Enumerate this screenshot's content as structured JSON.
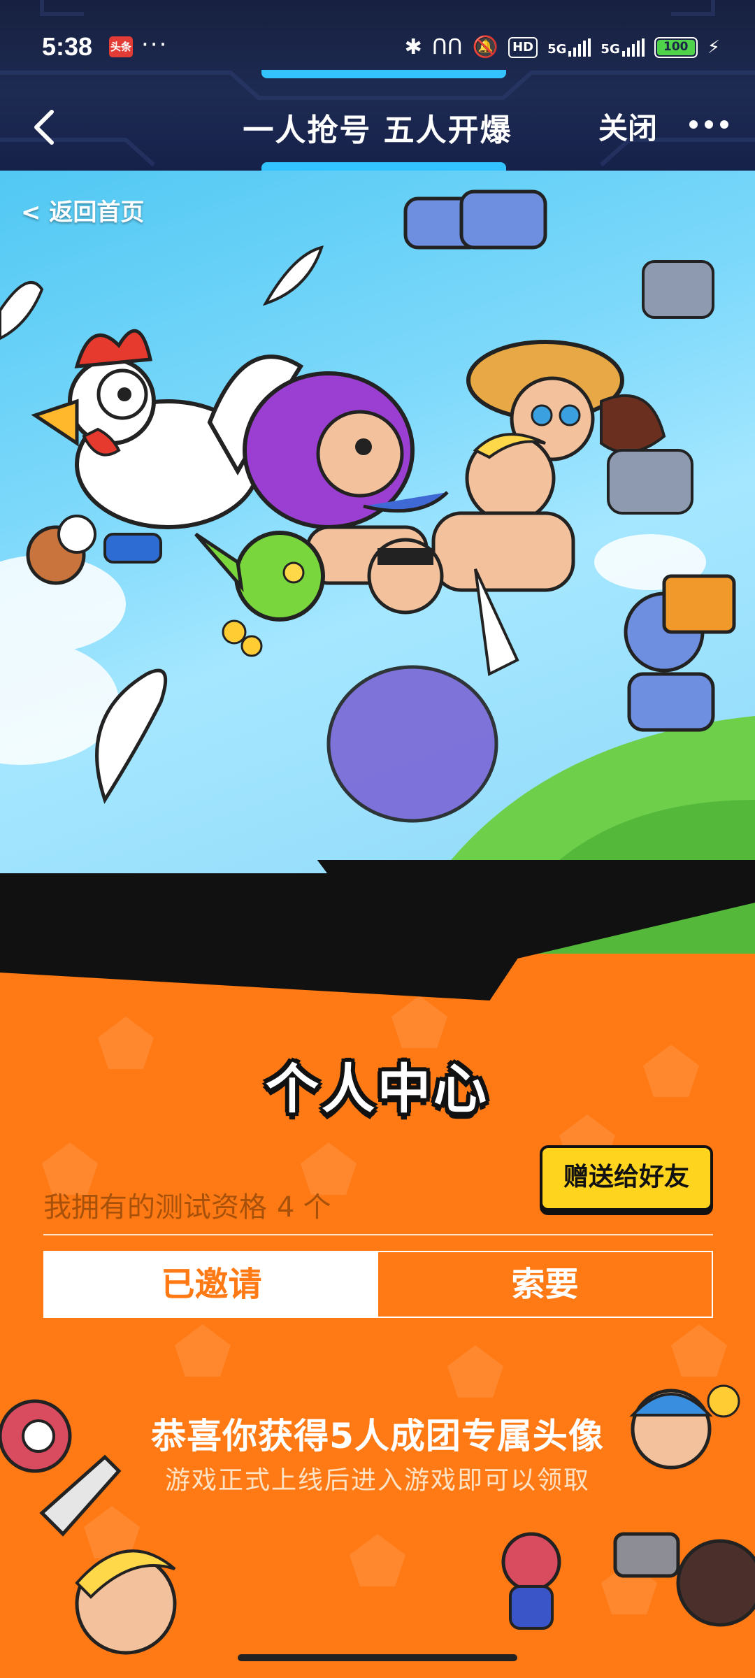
{
  "status_bar": {
    "time": "5:38",
    "app_badge": "头条",
    "more": "···",
    "hd_label": "HD",
    "signal1": "5G",
    "signal2": "5G",
    "battery": "100"
  },
  "nav": {
    "title": "一人抢号 五人开爆",
    "close_label": "关闭"
  },
  "hero": {
    "back_home_label": "< 返回首页"
  },
  "personal": {
    "title": "个人中心",
    "gift_button": "赠送给好友",
    "quota_label": "我拥有的测试资格",
    "quota_count": "4",
    "quota_unit": "个",
    "tabs": [
      {
        "label": "已邀请",
        "active": true
      },
      {
        "label": "索要",
        "active": false
      }
    ],
    "congrats_title": "恭喜你获得5人成团专属头像",
    "congrats_sub": "游戏正式上线后进入游戏即可以领取"
  },
  "colors": {
    "orange": "#ff7a14",
    "nav_bg": "#1d2a52",
    "accent_blue": "#33c4ff",
    "gift_yellow": "#ffd41f"
  }
}
